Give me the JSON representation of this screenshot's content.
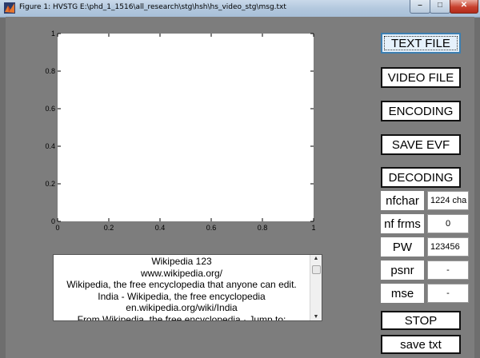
{
  "window": {
    "title": "Figure 1:  HVSTG E:\\phd_1_1516\\all_research\\stg\\hsh\\hs_video_stg\\msg.txt",
    "controls": {
      "minimize": "–",
      "maximize": "□",
      "close": "✕"
    },
    "icon": "matlab-icon"
  },
  "chart_data": {
    "type": "line",
    "xlim": [
      0,
      1
    ],
    "ylim": [
      0,
      1
    ],
    "xticks": [
      "0",
      "0.2",
      "0.4",
      "0.6",
      "0.8",
      "1"
    ],
    "yticks": [
      "0",
      "0.2",
      "0.4",
      "0.6",
      "0.8",
      "1"
    ],
    "series": [],
    "title": "",
    "xlabel": "",
    "ylabel": "",
    "grid": false
  },
  "listbox": {
    "lines": [
      "Wikipedia 123",
      "www.wikipedia.org/",
      "Wikipedia, the free encyclopedia that anyone can edit.",
      "India - Wikipedia, the free encyclopedia",
      "en.wikipedia.org/wiki/India",
      "From Wikipedia, the free encyclopedia · Jump to:"
    ],
    "scroll_up": "▲",
    "scroll_down": "▼"
  },
  "buttons": {
    "text_file": "TEXT FILE",
    "video_file": "VIDEO FILE",
    "encoding": "ENCODING",
    "save_evf": "SAVE EVF",
    "decoding": "DECODING",
    "stop": "STOP",
    "save_txt": "save txt"
  },
  "params": [
    {
      "label": "nfchar",
      "value": "1224 cha"
    },
    {
      "label": "nf frms",
      "value": "0"
    },
    {
      "label": "PW",
      "value": "123456"
    },
    {
      "label": "psnr",
      "value": "-"
    },
    {
      "label": "mse",
      "value": "-"
    }
  ]
}
